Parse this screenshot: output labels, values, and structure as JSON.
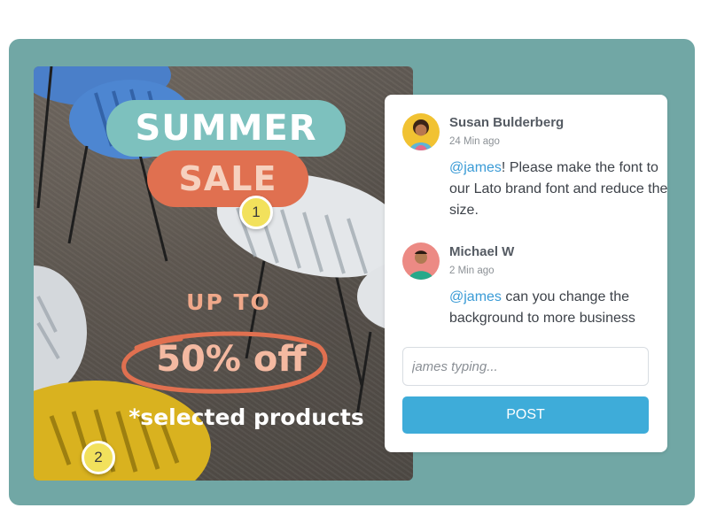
{
  "promo": {
    "title_top": "SUMMER",
    "title_bottom": "SALE",
    "up_to": "UP TO",
    "discount": "50% off",
    "note": "*selected products",
    "markers": [
      "1",
      "2"
    ]
  },
  "comments": [
    {
      "author": "Susan Bulderberg",
      "time": "24 Min ago",
      "mention": "@james",
      "text": "! Please make the font to our Lato brand font and reduce the size."
    },
    {
      "author": "Michael W",
      "time": "2 Min ago",
      "mention": "@james",
      "text": " can you change the background to more business"
    }
  ],
  "input": {
    "placeholder": "james typing..."
  },
  "post_label": "POST",
  "colors": {
    "stage": "#71a7a5",
    "accent_teal": "#7dc1be",
    "accent_orange": "#e07050",
    "mention": "#3a9bd6",
    "button": "#3eacd9",
    "marker": "#f2e15c"
  },
  "icons": [
    "avatar-susan",
    "avatar-michael"
  ]
}
